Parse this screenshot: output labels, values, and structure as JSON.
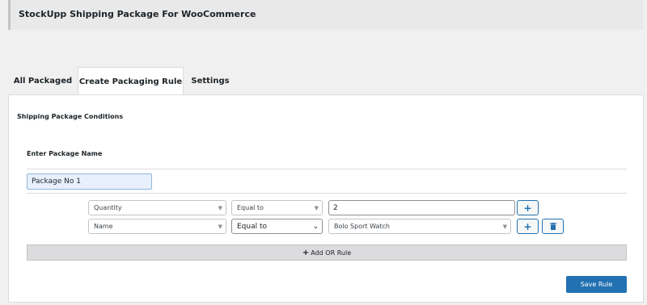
{
  "header": {
    "title": "StockUpp Shipping Package For WooCommerce"
  },
  "tabs": [
    {
      "label": "All Packaged"
    },
    {
      "label": "Create Packaging Rule"
    },
    {
      "label": "Settings"
    }
  ],
  "form": {
    "section_title": "Shipping Package Conditions",
    "package_name_label": "Enter Package Name",
    "package_name_value": "Package No 1",
    "rules": [
      {
        "field": "Quantity",
        "operator": "Equal to",
        "value": "2"
      },
      {
        "field": "Name",
        "operator": "Equal to",
        "value": "Bolo Sport Watch"
      }
    ],
    "add_or_rule_label": "Add OR Rule",
    "save_label": "Save Rule"
  },
  "icons": {
    "plus": "+",
    "trash": "trash-icon",
    "chevron": "chevron-down-icon"
  },
  "colors": {
    "accent": "#2271b1"
  }
}
